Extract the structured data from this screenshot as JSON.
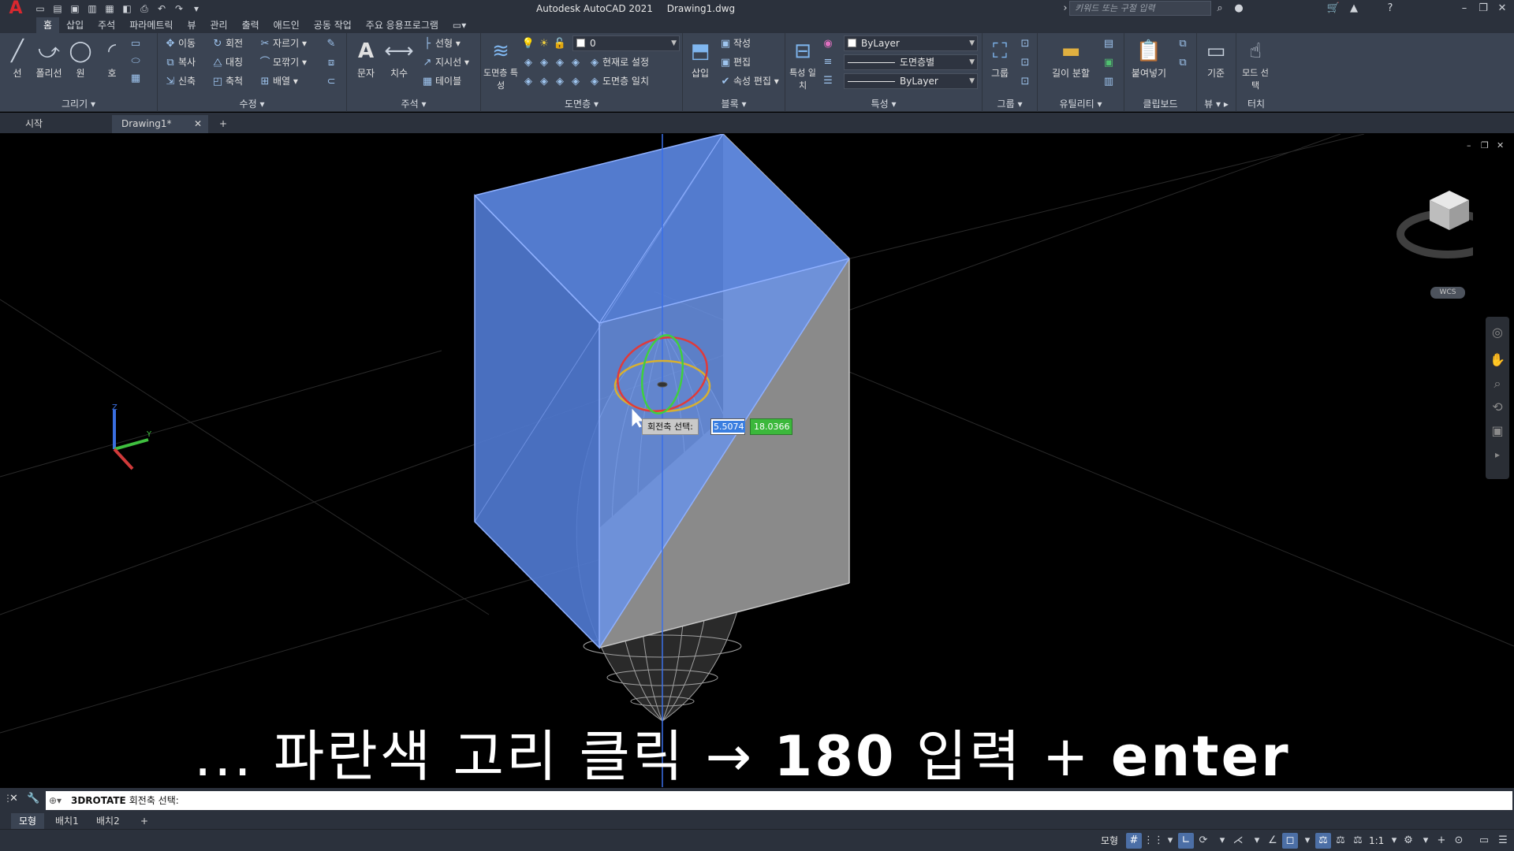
{
  "titlebar": {
    "app_name": "Autodesk AutoCAD 2021",
    "document": "Drawing1.dwg",
    "search_placeholder": "키워드 또는 구절 입력",
    "quick_access": [
      "new-icon",
      "open-icon",
      "save-icon",
      "save-as-icon",
      "plot-icon",
      "undo-icon",
      "redo-icon"
    ]
  },
  "ribbon_tabs": [
    "홈",
    "삽입",
    "주석",
    "파라메트릭",
    "뷰",
    "관리",
    "출력",
    "애드인",
    "공동 작업",
    "주요 응용프로그램"
  ],
  "ribbon": {
    "draw": {
      "title": "그리기",
      "line": "선",
      "polyline": "폴리선",
      "circle": "원",
      "arc": "호"
    },
    "modify": {
      "title": "수정",
      "move": "이동",
      "rotate": "회전",
      "trim": "자르기",
      "copy": "복사",
      "mirror": "대칭",
      "fillet": "모깎기",
      "stretch": "신축",
      "scale": "축척",
      "array": "배열"
    },
    "annotation": {
      "title": "주석",
      "text": "문자",
      "dimension": "치수",
      "linear": "선형",
      "leader": "지시선",
      "table": "테이블"
    },
    "layers": {
      "title": "도면층",
      "properties": "도면층 특성",
      "current_layer": "0",
      "make_current": "현재로 설정",
      "match_layer": "도면층 일치"
    },
    "block": {
      "title": "블록",
      "insert": "삽입",
      "create": "작성",
      "edit": "편집",
      "edit_attributes": "속성 편집"
    },
    "properties": {
      "title": "특성",
      "match": "특성 일치",
      "color": "ByLayer",
      "lineweight": "도면층별",
      "linetype": "ByLayer"
    },
    "groups": {
      "title": "그룹",
      "group": "그룹"
    },
    "utilities": {
      "title": "유틸리티",
      "measure": "길이 분할"
    },
    "clipboard": {
      "title": "클립보드",
      "paste": "붙여넣기"
    },
    "view": {
      "title": "뷰",
      "base": "기준"
    },
    "touch": {
      "title": "터치",
      "select_mode": "모드 선택"
    }
  },
  "file_tabs": {
    "start": "시작",
    "current": "Drawing1*"
  },
  "viewport": {
    "wcs_label": "WCS",
    "dynamic_input": {
      "prompt": "회전축 선택:",
      "x_value": "5.5074",
      "y_value": "18.0366"
    },
    "caption": {
      "prefix": "... 파란색 고리 클릭 →",
      "number": "180",
      "middle": "입력 +",
      "key": "enter"
    }
  },
  "command_line": {
    "command": "3DROTATE",
    "prompt": "회전축 선택:"
  },
  "layout_tabs": [
    "모형",
    "배치1",
    "배치2"
  ],
  "statusbar": {
    "model_label": "모형",
    "scale": "1:1"
  },
  "colors": {
    "selection_blue": "#5a86e0",
    "gizmo_x": "#e03a3a",
    "gizmo_y": "#3fcf3f",
    "gizmo_z": "#e0c040",
    "ui_dark": "#2b313c",
    "ui_ribbon": "#3b4453"
  }
}
